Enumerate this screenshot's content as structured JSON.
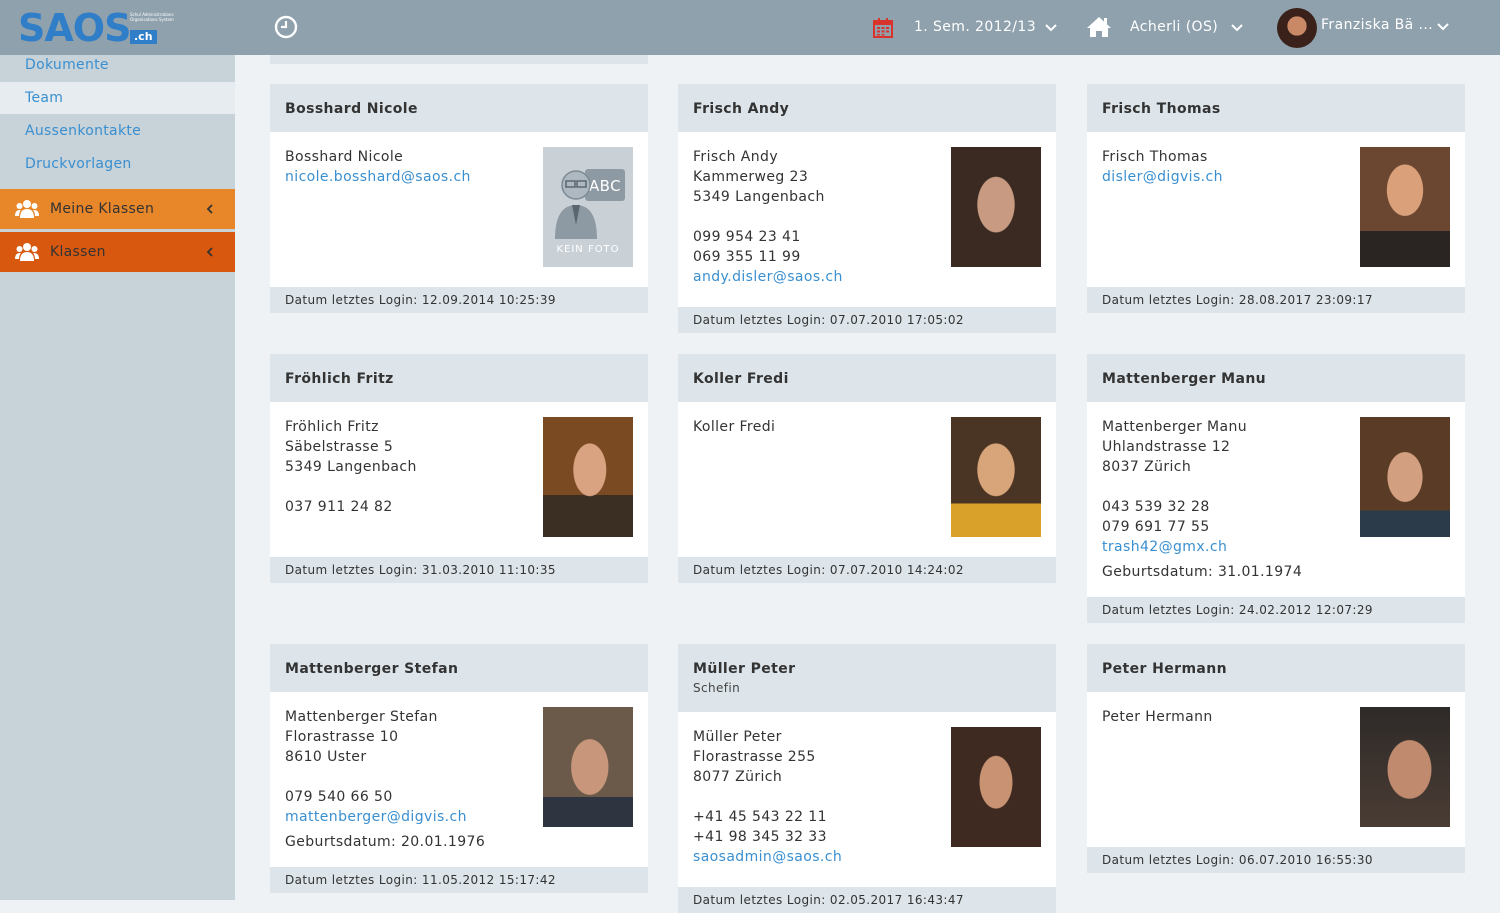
{
  "header": {
    "logo": "SAOS",
    "logo_tld": ".ch",
    "logo_sub": "Schul Administrations Organisations System",
    "semester": "1. Sem. 2012/13",
    "school": "Acherli (OS)",
    "user": "Franziska Bä ...",
    "colors": {
      "bar": "#8fa1ad",
      "accent": "#2f7ec7",
      "calendar": "#d9342b"
    },
    "icons": [
      "clock-icon",
      "calendar-icon",
      "home-icon",
      "chevron-down-icon"
    ]
  },
  "sidebar": {
    "links": [
      {
        "label": "Dokumente",
        "active": false
      },
      {
        "label": "Team",
        "active": true
      },
      {
        "label": "Aussenkontakte",
        "active": false
      },
      {
        "label": "Druckvorlagen",
        "active": false
      }
    ],
    "sections": [
      {
        "label": "Meine Klassen",
        "color": "#e8862a"
      },
      {
        "label": "Klassen",
        "color": "#d8580f"
      }
    ]
  },
  "no_photo_label": "KEIN FOTO",
  "cards": [
    {
      "title": "Bosshard Nicole",
      "lines": [
        "Bosshard Nicole"
      ],
      "email": "nicole.bosshard@saos.ch",
      "login": "Datum letztes Login: 12.09.2014 10:25:39"
    },
    {
      "title": "Frisch Andy",
      "lines": [
        "Frisch Andy",
        "Kammerweg 23",
        "5349 Langenbach",
        "099 954 23 41",
        "069 355 11 99"
      ],
      "email": "andy.disler@saos.ch",
      "login": "Datum letztes Login: 07.07.2010 17:05:02"
    },
    {
      "title": "Frisch Thomas",
      "lines": [
        "Frisch Thomas"
      ],
      "email": "disler@digvis.ch",
      "login": "Datum letztes Login: 28.08.2017 23:09:17"
    },
    {
      "title": "Fröhlich Fritz",
      "lines": [
        "Fröhlich Fritz",
        "Säbelstrasse 5",
        "5349 Langenbach",
        "037 911 24 82"
      ],
      "login": "Datum letztes Login: 31.03.2010 11:10:35"
    },
    {
      "title": "Koller Fredi",
      "lines": [
        "Koller Fredi"
      ],
      "login": "Datum letztes Login: 07.07.2010 14:24:02"
    },
    {
      "title": "Mattenberger Manu",
      "lines": [
        "Mattenberger Manu",
        "Uhlandstrasse 12",
        "8037 Zürich",
        "043 539 32 28",
        "079 691 77 55"
      ],
      "email": "trash42@gmx.ch",
      "birthday": "Geburtsdatum: 31.01.1974",
      "login": "Datum letztes Login: 24.02.2012 12:07:29"
    },
    {
      "title": "Mattenberger Stefan",
      "lines": [
        "Mattenberger Stefan",
        "Florastrasse 10",
        "8610 Uster",
        "079 540 66 50"
      ],
      "email": "mattenberger@digvis.ch",
      "birthday": "Geburtsdatum: 20.01.1976",
      "login": "Datum letztes Login: 11.05.2012 15:17:42"
    },
    {
      "title": "Müller Peter",
      "subtitle": "Schefin",
      "lines": [
        "Müller Peter",
        "Florastrasse 255",
        "8077 Zürich",
        "+41 45 543 22 11",
        "+41 98 345 32 33"
      ],
      "email": "saosadmin@saos.ch",
      "login": "Datum letztes Login: 02.05.2017 16:43:47"
    },
    {
      "title": "Peter Hermann",
      "lines": [
        "Peter Hermann"
      ],
      "login": "Datum letztes Login: 06.07.2010 16:55:30"
    }
  ]
}
